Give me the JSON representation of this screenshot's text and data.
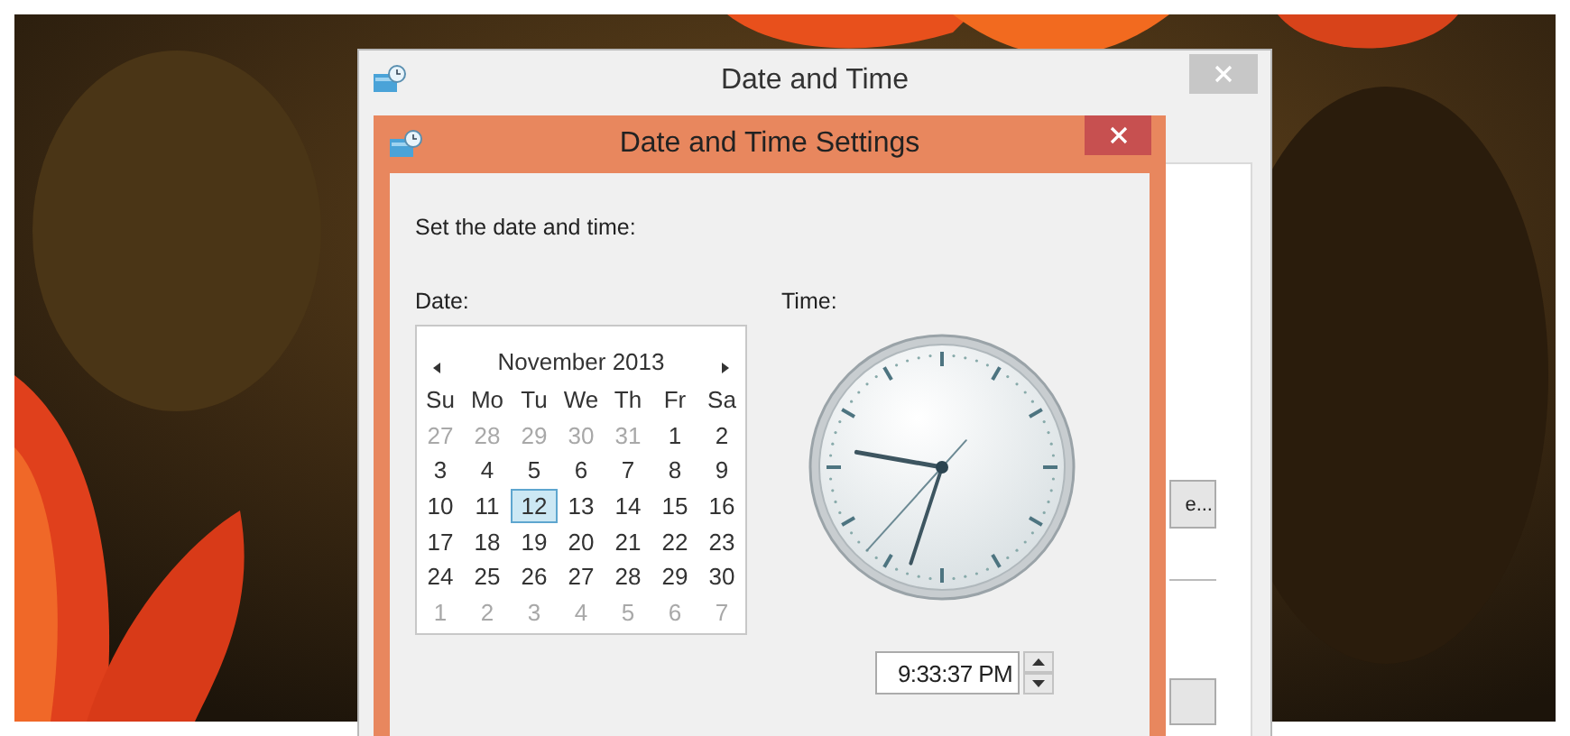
{
  "outer_window": {
    "title": "Date and Time",
    "button_text": "e..."
  },
  "dialog": {
    "title": "Date and Time Settings",
    "instruction": "Set the date and time:",
    "date_label": "Date:",
    "time_label": "Time:",
    "time_value": "9:33:37 PM"
  },
  "calendar": {
    "month": "November 2013",
    "weekdays": [
      "Su",
      "Mo",
      "Tu",
      "We",
      "Th",
      "Fr",
      "Sa"
    ],
    "days": [
      {
        "day": "27",
        "muted": true,
        "selected": false
      },
      {
        "day": "28",
        "muted": true,
        "selected": false
      },
      {
        "day": "29",
        "muted": true,
        "selected": false
      },
      {
        "day": "30",
        "muted": true,
        "selected": false
      },
      {
        "day": "31",
        "muted": true,
        "selected": false
      },
      {
        "day": "1",
        "muted": false,
        "selected": false
      },
      {
        "day": "2",
        "muted": false,
        "selected": false
      },
      {
        "day": "3",
        "muted": false,
        "selected": false
      },
      {
        "day": "4",
        "muted": false,
        "selected": false
      },
      {
        "day": "5",
        "muted": false,
        "selected": false
      },
      {
        "day": "6",
        "muted": false,
        "selected": false
      },
      {
        "day": "7",
        "muted": false,
        "selected": false
      },
      {
        "day": "8",
        "muted": false,
        "selected": false
      },
      {
        "day": "9",
        "muted": false,
        "selected": false
      },
      {
        "day": "10",
        "muted": false,
        "selected": false
      },
      {
        "day": "11",
        "muted": false,
        "selected": false
      },
      {
        "day": "12",
        "muted": false,
        "selected": true
      },
      {
        "day": "13",
        "muted": false,
        "selected": false
      },
      {
        "day": "14",
        "muted": false,
        "selected": false
      },
      {
        "day": "15",
        "muted": false,
        "selected": false
      },
      {
        "day": "16",
        "muted": false,
        "selected": false
      },
      {
        "day": "17",
        "muted": false,
        "selected": false
      },
      {
        "day": "18",
        "muted": false,
        "selected": false
      },
      {
        "day": "19",
        "muted": false,
        "selected": false
      },
      {
        "day": "20",
        "muted": false,
        "selected": false
      },
      {
        "day": "21",
        "muted": false,
        "selected": false
      },
      {
        "day": "22",
        "muted": false,
        "selected": false
      },
      {
        "day": "23",
        "muted": false,
        "selected": false
      },
      {
        "day": "24",
        "muted": false,
        "selected": false
      },
      {
        "day": "25",
        "muted": false,
        "selected": false
      },
      {
        "day": "26",
        "muted": false,
        "selected": false
      },
      {
        "day": "27",
        "muted": false,
        "selected": false
      },
      {
        "day": "28",
        "muted": false,
        "selected": false
      },
      {
        "day": "29",
        "muted": false,
        "selected": false
      },
      {
        "day": "30",
        "muted": false,
        "selected": false
      },
      {
        "day": "1",
        "muted": true,
        "selected": false
      },
      {
        "day": "2",
        "muted": true,
        "selected": false
      },
      {
        "day": "3",
        "muted": true,
        "selected": false
      },
      {
        "day": "4",
        "muted": true,
        "selected": false
      },
      {
        "day": "5",
        "muted": true,
        "selected": false
      },
      {
        "day": "6",
        "muted": true,
        "selected": false
      },
      {
        "day": "7",
        "muted": true,
        "selected": false
      }
    ]
  }
}
